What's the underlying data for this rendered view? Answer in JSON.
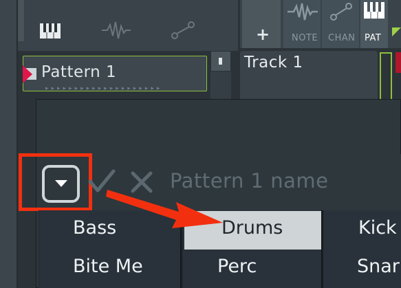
{
  "pattern_slot": {
    "label": "Pattern 1"
  },
  "tabs": [
    {
      "label": "+"
    },
    {
      "label": "NOTE"
    },
    {
      "label": "CHAN"
    },
    {
      "label": "PAT"
    }
  ],
  "track": {
    "label": "Track 1"
  },
  "rename_dialog": {
    "name_value": "Pattern 1 name"
  },
  "menu": {
    "columns": [
      [
        "Bass",
        "Bite Me"
      ],
      [
        "Drums",
        "Perc"
      ],
      [
        "Kick",
        "Snar"
      ]
    ],
    "selected": "Drums"
  },
  "colors": {
    "highlight": "#f2300f",
    "accent_green": "#8fbf3f",
    "selected_bg": "#cfd4d7"
  },
  "icons": [
    "piano-icon",
    "waveform-icon",
    "node-link-icon",
    "dropdown-arrow-icon",
    "checkmark-icon",
    "close-icon"
  ]
}
